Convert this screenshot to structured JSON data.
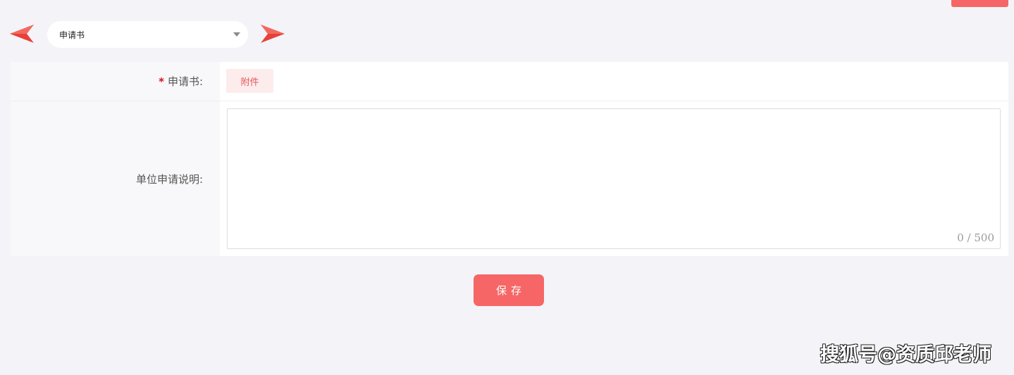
{
  "nav": {
    "prev_icon": "left-arrow-icon",
    "next_icon": "right-arrow-icon",
    "arrow_color": "#e8403a"
  },
  "selector": {
    "value": "申请书",
    "icon": "caret-down-icon"
  },
  "form": {
    "application_row": {
      "required_mark": "*",
      "label": "申请书:",
      "attach_label": "附件"
    },
    "description_row": {
      "label": "单位申请说明:",
      "value": "",
      "counter": "0 /  500"
    }
  },
  "actions": {
    "save_label": "保存"
  },
  "watermark": {
    "text": "搜狐号@资质邱老师"
  },
  "colors": {
    "accent": "#f66666",
    "attach_bg": "#fdecec",
    "attach_text": "#e3575b",
    "required": "#d31515",
    "background": "#f4f4f8"
  }
}
